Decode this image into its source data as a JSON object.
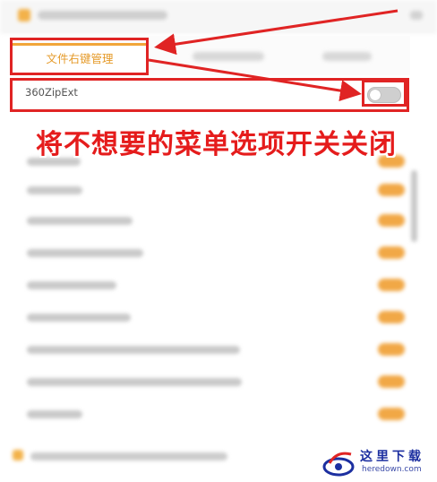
{
  "tab_active": {
    "label": "文件右键管理"
  },
  "first_item": {
    "name": "360ZipExt",
    "toggle_state": "off"
  },
  "caption": "将不想要的菜单选项开关关闭",
  "watermark": {
    "brand": "这里下载",
    "url": "heredown.com"
  },
  "colors": {
    "accent": "#f1a53a",
    "annotation": "#e02424",
    "toggle_off": "#cfcfcf"
  }
}
